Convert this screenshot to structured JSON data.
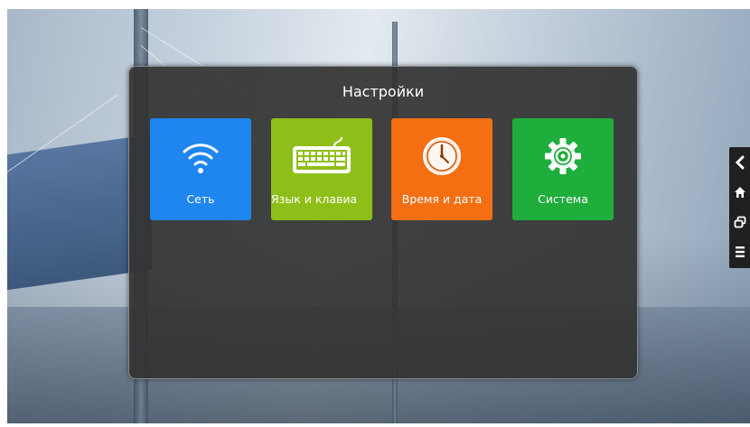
{
  "dialog": {
    "title": "Настройки"
  },
  "tiles": [
    {
      "label": "Сеть",
      "icon": "wifi-icon",
      "color": "#1f86f0"
    },
    {
      "label": "Язык и клавиа",
      "icon": "keyboard-icon",
      "color": "#8ebf18"
    },
    {
      "label": "Время и дата",
      "icon": "clock-icon",
      "color": "#f36f12"
    },
    {
      "label": "Система",
      "icon": "gear-icon",
      "color": "#1fad3c"
    }
  ],
  "side_nav": {
    "items": [
      {
        "icon": "back-icon"
      },
      {
        "icon": "home-icon"
      },
      {
        "icon": "recent-apps-icon"
      },
      {
        "icon": "menu-icon"
      }
    ]
  }
}
